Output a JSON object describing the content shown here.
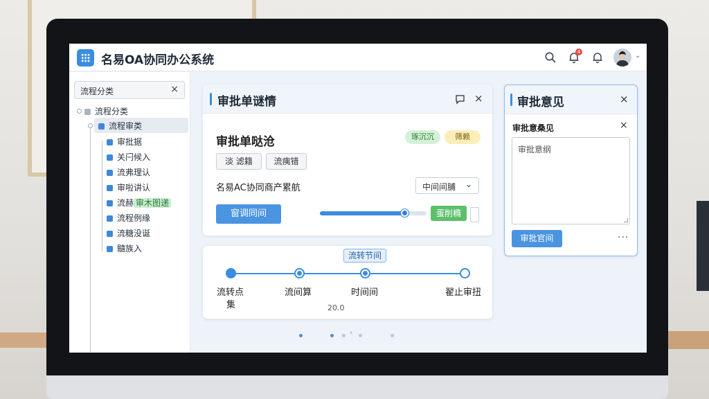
{
  "header": {
    "app_title": "名易OA协同办公系统",
    "icons": [
      "grid-icon",
      "search-icon",
      "bell-icon",
      "notification-icon",
      "user-avatar"
    ],
    "notification_count": "4"
  },
  "sidebar": {
    "search_label": "流程分类",
    "root_label": "流程分类",
    "selected_label": "流程审类",
    "items": [
      {
        "label": "审批据"
      },
      {
        "label": "关闩候入"
      },
      {
        "label": "流弗理认"
      },
      {
        "label": "审啦讲认"
      },
      {
        "label_prefix": "流赫",
        "label_tag": "审木图递"
      },
      {
        "label": "流程例缘"
      },
      {
        "label": "流糖没诞"
      },
      {
        "label": "髓族入"
      }
    ]
  },
  "detail_card": {
    "title": "审批单谜情",
    "subtitle": "审批单哒沧",
    "tag_green": "琢沉沉",
    "tag_yellow": "筛赖",
    "btn_tag1": "淡 滤籍",
    "btn_tag2": "流痍错",
    "row_label": "名易AC协同商产累航",
    "select_value": "中间间脯",
    "primary_button": "窗调同间",
    "green_button": "蛋削橢",
    "slider_value": 0.8
  },
  "timeline": {
    "label": "流转节间",
    "steps": [
      {
        "label": "流转点",
        "label2": "集",
        "state": "filled"
      },
      {
        "label": "流间算",
        "state": "ring"
      },
      {
        "label": "时间间",
        "state": "ring"
      },
      {
        "label": "翟止审扭",
        "state": "empty"
      }
    ],
    "value": "20.0"
  },
  "opinion_card": {
    "title": "审批意见",
    "subtitle": "审批意桑见",
    "textarea_value": "审批意纲",
    "submit_button": "审批官间",
    "more_label": "···"
  },
  "colors": {
    "accent": "#3a8de0",
    "success": "#5cbf6a",
    "warning_bg": "#fbeeb8"
  }
}
